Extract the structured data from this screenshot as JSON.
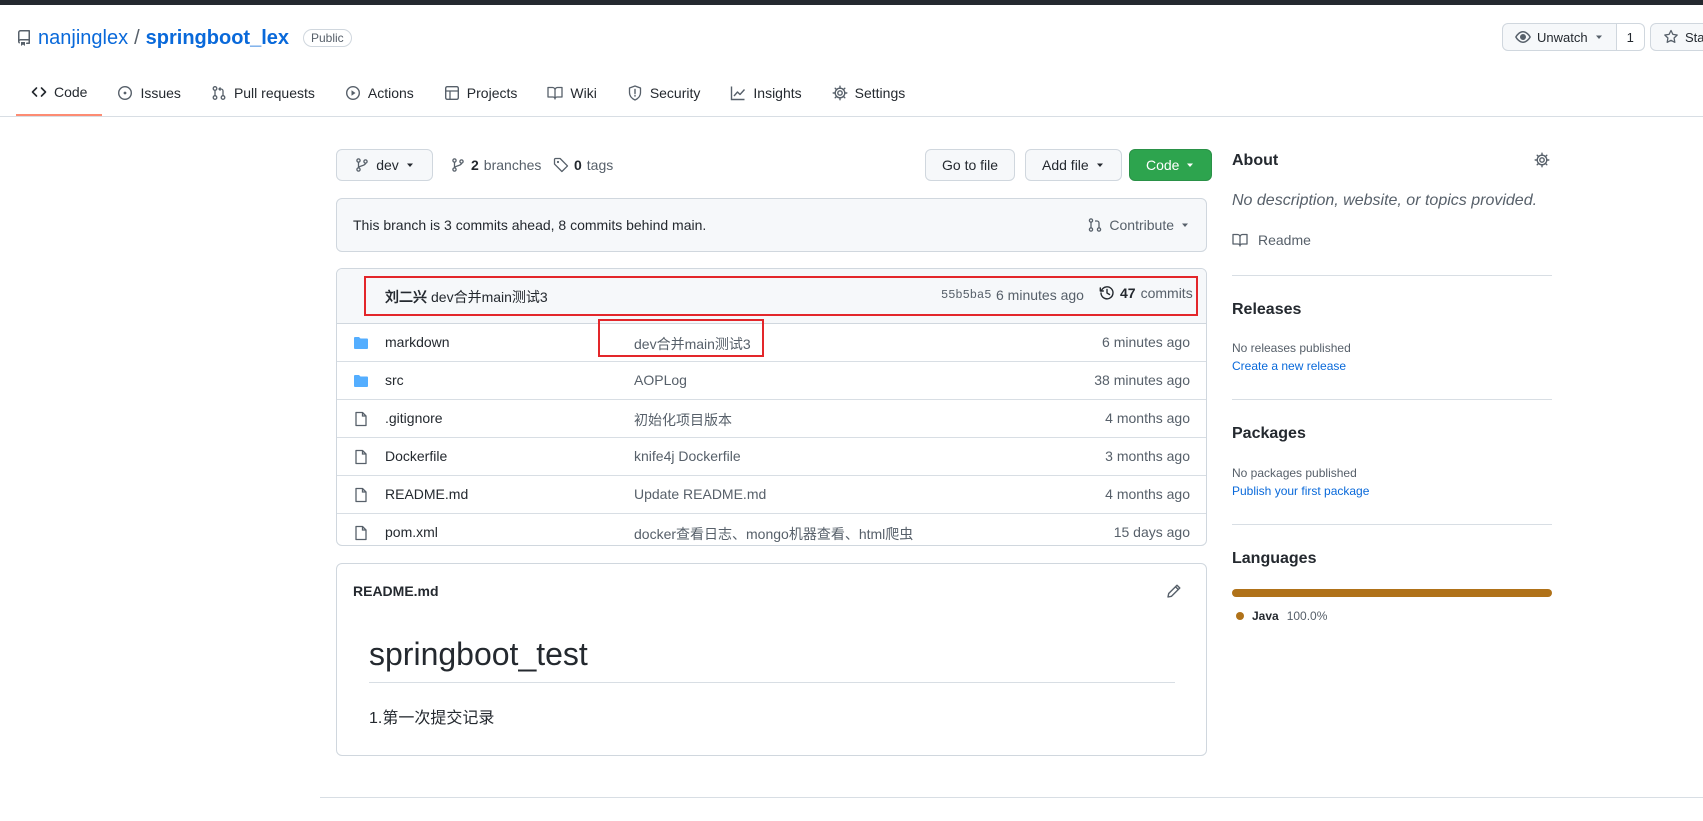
{
  "repo": {
    "owner": "nanjinglex",
    "separator": "/",
    "name": "springboot_lex",
    "visibility": "Public"
  },
  "header_actions": {
    "watch_label": "Unwatch",
    "watch_count": "1",
    "star_label": "Sta"
  },
  "tabs": [
    {
      "label": "Code",
      "icon": "code-icon",
      "active": true
    },
    {
      "label": "Issues",
      "icon": "issue-icon"
    },
    {
      "label": "Pull requests",
      "icon": "pull-request-icon"
    },
    {
      "label": "Actions",
      "icon": "play-icon"
    },
    {
      "label": "Projects",
      "icon": "table-icon"
    },
    {
      "label": "Wiki",
      "icon": "book-icon"
    },
    {
      "label": "Security",
      "icon": "shield-icon"
    },
    {
      "label": "Insights",
      "icon": "graph-icon"
    },
    {
      "label": "Settings",
      "icon": "gear-icon"
    }
  ],
  "branch_bar": {
    "branch": "dev",
    "branches_count": "2",
    "branches_label": "branches",
    "tags_count": "0",
    "tags_label": "tags",
    "goto_file": "Go to file",
    "add_file": "Add file",
    "code": "Code"
  },
  "branch_status": {
    "text": "This branch is 3 commits ahead, 8 commits behind main.",
    "contribute": "Contribute"
  },
  "latest_commit": {
    "author": "刘二兴",
    "message": "dev合并main测试3",
    "sha": "55b5ba5",
    "time": "6 minutes ago",
    "commits_count": "47",
    "commits_label": "commits"
  },
  "files": [
    {
      "name": "markdown",
      "type": "folder",
      "message": "dev合并main测试3",
      "time": "6 minutes ago"
    },
    {
      "name": "src",
      "type": "folder",
      "message": "AOPLog",
      "time": "38 minutes ago"
    },
    {
      "name": ".gitignore",
      "type": "file",
      "message": "初始化项目版本",
      "time": "4 months ago"
    },
    {
      "name": "Dockerfile",
      "type": "file",
      "message": "knife4j Dockerfile",
      "time": "3 months ago"
    },
    {
      "name": "README.md",
      "type": "file",
      "message": "Update README.md",
      "time": "4 months ago"
    },
    {
      "name": "pom.xml",
      "type": "file",
      "message": "docker查看日志、mongo机器查看、html爬虫",
      "time": "15 days ago"
    }
  ],
  "readme": {
    "filename": "README.md",
    "heading": "springboot_test",
    "body": "1.第一次提交记录"
  },
  "sidebar": {
    "about_title": "About",
    "about_desc": "No description, website, or topics provided.",
    "readme_label": "Readme",
    "releases_title": "Releases",
    "releases_text": "No releases published",
    "releases_link": "Create a new release",
    "packages_title": "Packages",
    "packages_text": "No packages published",
    "packages_link": "Publish your first package",
    "languages_title": "Languages",
    "languages": [
      {
        "name": "Java",
        "percent": "100.0%",
        "color": "#b07219"
      }
    ]
  },
  "colors": {
    "link": "#0969da",
    "primary_button": "#2da44e",
    "active_tab": "#fd8c73",
    "annotation_red": "#e3262a",
    "java": "#b07219"
  }
}
